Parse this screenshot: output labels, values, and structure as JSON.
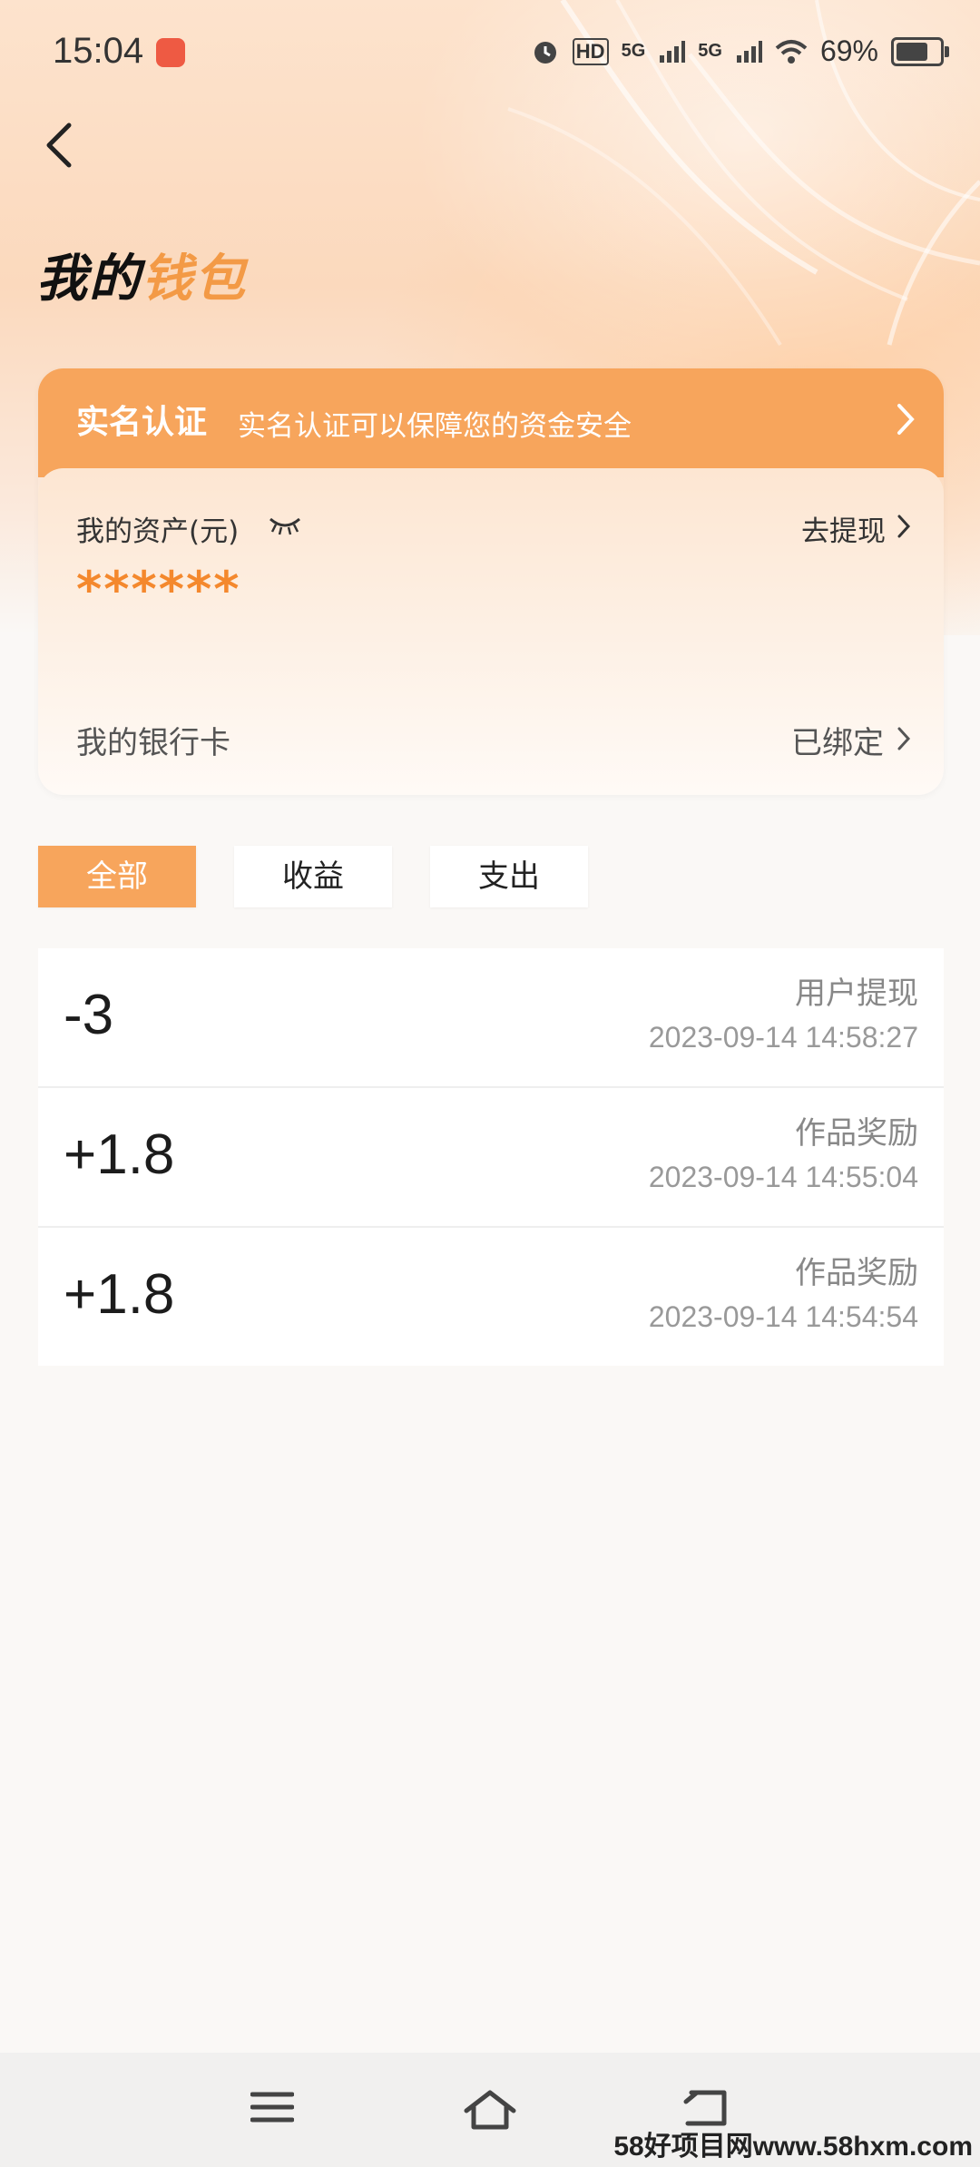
{
  "status_bar": {
    "time": "15:04",
    "battery": "69%",
    "network_labels": [
      "HD",
      "5G",
      "5G"
    ]
  },
  "page": {
    "title_part1": "我的",
    "title_part2": "钱包"
  },
  "verification": {
    "title": "实名认证",
    "description": "实名认证可以保障您的资金安全"
  },
  "assets": {
    "label": "我的资产(元)",
    "withdraw_label": "去提现",
    "masked_value": "******"
  },
  "bank_card": {
    "label": "我的银行卡",
    "status": "已绑定"
  },
  "tabs": [
    {
      "label": "全部",
      "active": true
    },
    {
      "label": "收益",
      "active": false
    },
    {
      "label": "支出",
      "active": false
    }
  ],
  "transactions": [
    {
      "amount": "-3",
      "description": "用户提现",
      "datetime": "2023-09-14 14:58:27"
    },
    {
      "amount": "+1.8",
      "description": "作品奖励",
      "datetime": "2023-09-14 14:55:04"
    },
    {
      "amount": "+1.8",
      "description": "作品奖励",
      "datetime": "2023-09-14 14:54:54"
    }
  ],
  "watermark": "58好项目网www.58hxm.com",
  "colors": {
    "accent": "#f7a55c",
    "star": "#f4882d",
    "title_highlight": "#f39a46"
  }
}
